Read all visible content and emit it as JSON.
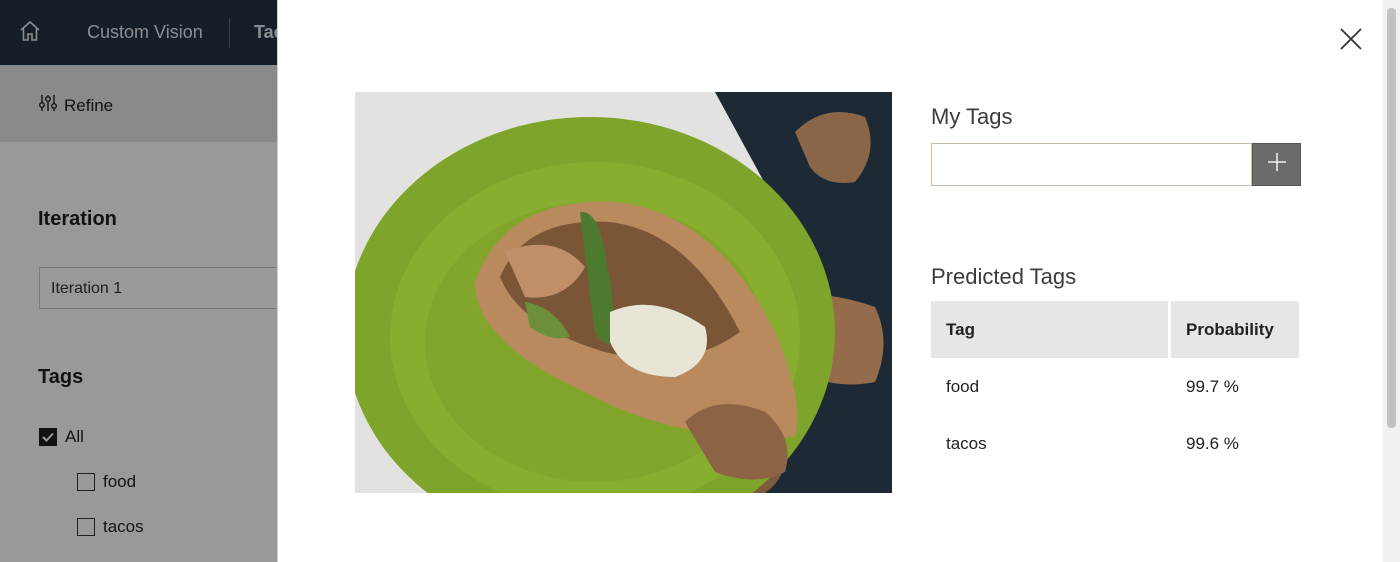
{
  "app": {
    "title": "Custom Vision",
    "breadcrumb": "Tacos"
  },
  "toolbar": {
    "refine_label": "Refine"
  },
  "sidebar": {
    "iteration_heading": "Iteration",
    "iteration_value": "Iteration 1",
    "tags_heading": "Tags",
    "tag_filters": [
      {
        "label": "All",
        "checked": true
      },
      {
        "label": "food",
        "checked": false
      },
      {
        "label": "tacos",
        "checked": false
      }
    ]
  },
  "modal": {
    "my_tags_title": "My Tags",
    "tag_input_value": "",
    "predicted_tags_title": "Predicted Tags",
    "table": {
      "headers": [
        "Tag",
        "Probability"
      ],
      "rows": [
        {
          "tag": "food",
          "probability": "99.7 %"
        },
        {
          "tag": "tacos",
          "probability": "99.6 %"
        }
      ]
    }
  },
  "colors": {
    "topbar": "#233446",
    "plate_green": "#7fa42c",
    "add_button": "#6b6b6b"
  },
  "icons": [
    "home-icon",
    "refine-sliders-icon",
    "close-icon",
    "plus-icon",
    "checkmark-icon"
  ]
}
